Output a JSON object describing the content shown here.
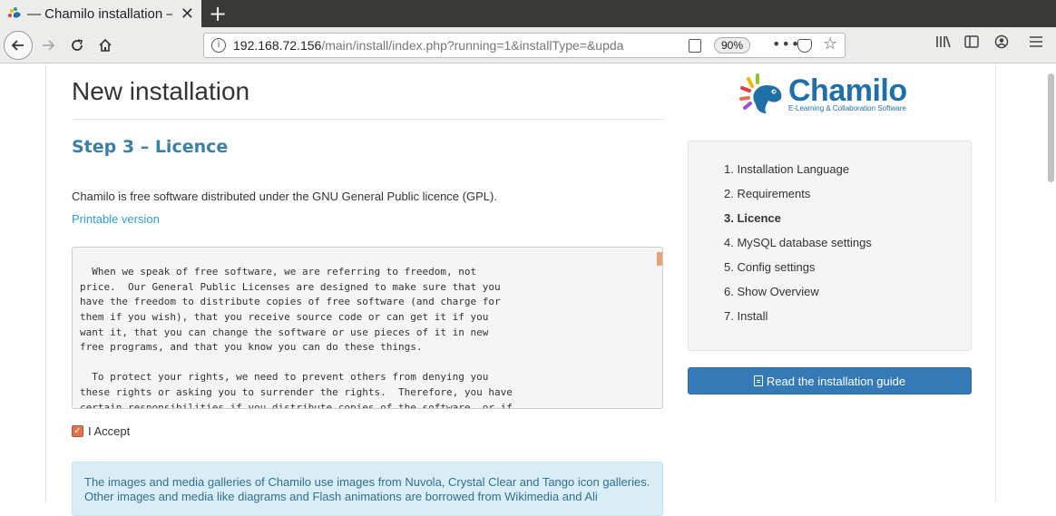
{
  "browser": {
    "tab_title": "— Chamilo installation —",
    "tab_close": "✕",
    "new_tab": "+",
    "url_host": "192.168.72.156",
    "url_path": "/main/install/index.php?running=1&installType=&upda",
    "zoom": "90%"
  },
  "header": {
    "page_title": "New installation",
    "logo_word": "Chamilo",
    "logo_tagline": "E-Learning & Collaboration Software"
  },
  "step": {
    "title": "Step 3 – Licence",
    "intro": "Chamilo is free software distributed under the GNU General Public licence (GPL).",
    "printable_link": "Printable version",
    "licence_text": "software and other kinds of works.\n\n  When we speak of free software, we are referring to freedom, not\nprice.  Our General Public Licenses are designed to make sure that you\nhave the freedom to distribute copies of free software (and charge for\nthem if you wish), that you receive source code or can get it if you\nwant it, that you can change the software or use pieces of it in new\nfree programs, and that you know you can do these things.\n\n  To protect your rights, we need to prevent others from denying you\nthese rights or asking you to surrender the rights.  Therefore, you have\ncertain responsibilities if you distribute copies of the software, or if",
    "accept_label": "I Accept",
    "accept_checked": true,
    "info": "The images and media galleries of Chamilo use images from Nuvola, Crystal Clear and Tango icon galleries. Other images and media like diagrams and Flash animations are borrowed from Wikimedia and Ali"
  },
  "sidebar": {
    "steps": [
      {
        "label": "1. Installation Language",
        "active": false
      },
      {
        "label": "2. Requirements",
        "active": false
      },
      {
        "label": "3. Licence",
        "active": true
      },
      {
        "label": "4. MySQL database settings",
        "active": false
      },
      {
        "label": "5. Config settings",
        "active": false
      },
      {
        "label": "6. Show Overview",
        "active": false
      },
      {
        "label": "7. Install",
        "active": false
      }
    ],
    "guide_button": "Read the installation guide"
  },
  "colors": {
    "accent": "#3b7fa3",
    "link": "#2a9fd6",
    "primary_button": "#337ab7",
    "checkbox": "#e0744b",
    "info_bg": "#d9edf7"
  }
}
